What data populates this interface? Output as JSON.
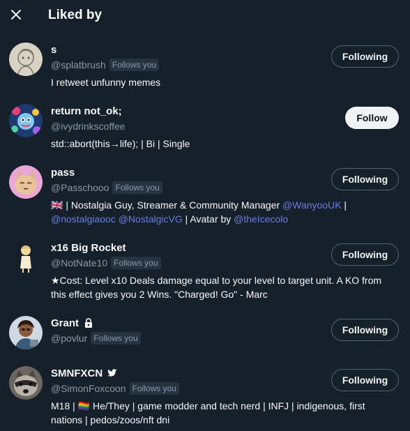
{
  "header": {
    "title": "Liked by",
    "close_icon": "close-icon"
  },
  "users": [
    {
      "name": "s",
      "handle": "@splatbrush",
      "follows_you": "Follows you",
      "bio": "I retweet unfunny memes",
      "button": "Following"
    },
    {
      "name": "return not_ok;",
      "handle": "@ivydrinkscoffee",
      "bio": "std::abort(this→life); | Bi | Single",
      "button": "Follow"
    },
    {
      "name": "pass",
      "handle": "@Passchooo",
      "follows_you": "Follows you",
      "bio_parts": {
        "p1": "🇬🇧 | Nostalgia Guy, Streamer & Community Manager ",
        "m1": "@WanyooUK",
        "p2": " | ",
        "m2": "@nostalgiaooc",
        "p3": " ",
        "m3": "@NostalgicVG",
        "p4": " | Avatar by ",
        "m4": "@theIcecolo"
      },
      "button": "Following"
    },
    {
      "name": "x16 Big Rocket",
      "handle": "@NotNate10",
      "follows_you": "Follows you",
      "bio": "★Cost: Level x10 Deals damage equal to your level to target unit. A KO from this effect gives you 2 Wins. \"Charged! Go\" - Marc",
      "button": "Following"
    },
    {
      "name": "Grant",
      "name_icon": "lock-icon",
      "handle": "@povlur",
      "follows_you": "Follows you",
      "button": "Following"
    },
    {
      "name": "SMNFXCN",
      "name_icon": "bird-icon",
      "handle": "@SimonFoxcoon",
      "follows_you": "Follows you",
      "bio": "M18 | 🏳️‍🌈 He/They | game modder and tech nerd | INFJ | indigenous, first nations | pedos/zoos/nft dni",
      "button": "Following"
    }
  ],
  "colors": {
    "background": "#15202b",
    "text": "#f7f9f9",
    "muted": "#8b98a5",
    "mention": "#6b7ce8",
    "badge_bg": "#273340",
    "button_border": "#536471"
  }
}
